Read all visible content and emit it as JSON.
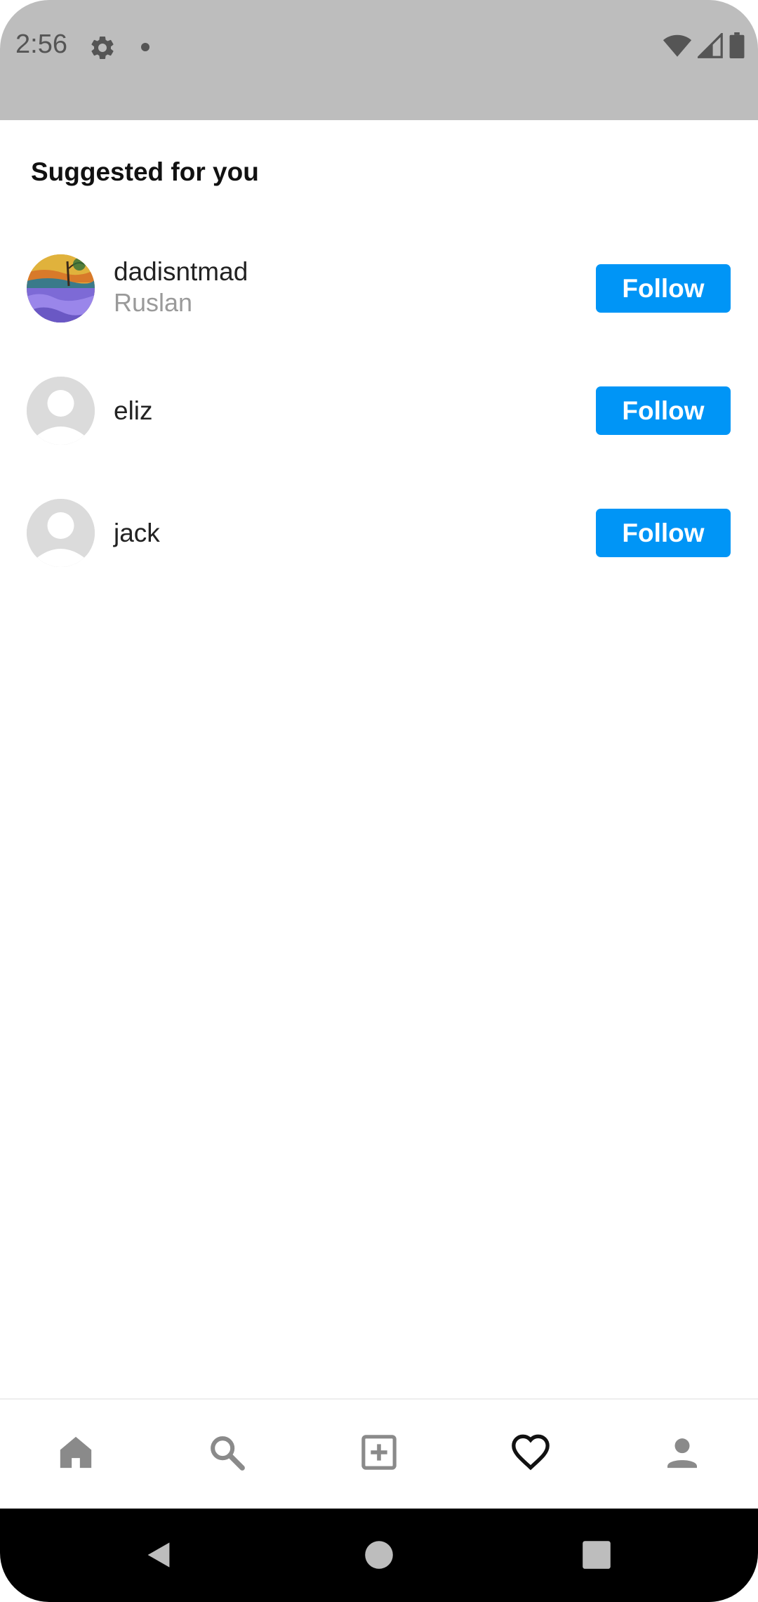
{
  "status_bar": {
    "time": "2:56",
    "icons": [
      "gear-icon",
      "notification-dot",
      "wifi-icon",
      "signal-icon",
      "battery-icon"
    ]
  },
  "suggestions": {
    "title": "Suggested for you",
    "users": [
      {
        "username": "dadisntmad",
        "fullname": "Ruslan",
        "follow_label": "Follow",
        "avatar": "painting"
      },
      {
        "username": "eliz",
        "fullname": "",
        "follow_label": "Follow",
        "avatar": "placeholder"
      },
      {
        "username": "jack",
        "fullname": "",
        "follow_label": "Follow",
        "avatar": "placeholder"
      }
    ]
  },
  "bottom_nav": {
    "items": [
      "home-icon",
      "search-icon",
      "add-post-icon",
      "heart-icon",
      "profile-icon"
    ],
    "active": "heart-icon"
  },
  "system_nav": {
    "items": [
      "back-icon",
      "home-circle-icon",
      "recents-icon"
    ]
  },
  "colors": {
    "accent": "#0095f6",
    "status_bar": "#bdbdbd",
    "nav_inactive": "#8a8a8a",
    "nav_active": "#111111"
  }
}
